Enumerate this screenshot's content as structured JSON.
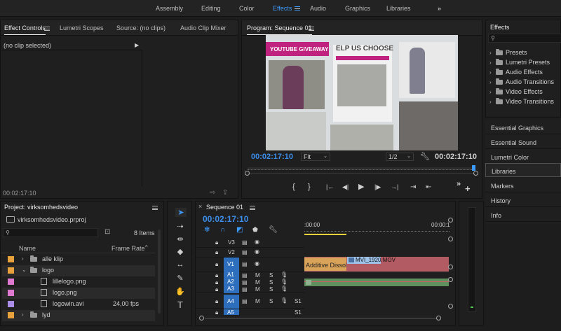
{
  "workspace": {
    "tabs": [
      "Assembly",
      "Editing",
      "Color",
      "Effects",
      "Audio",
      "Graphics",
      "Libraries"
    ],
    "active": "Effects",
    "more": "»"
  },
  "effect_controls": {
    "tabs": [
      "Effect Controls",
      "Lumetri Scopes",
      "Source: (no clips)",
      "Audio Clip Mixer"
    ],
    "no_clip": "(no clip selected)",
    "timecode": "00:02:17:10"
  },
  "program": {
    "title": "Program: Sequence 01",
    "timecode_left": "00:02:17:10",
    "fit": "Fit",
    "resolution": "1/2",
    "timecode_right": "00:02:17:10",
    "video_text_1": "YOUTUBE GIVEAWAY",
    "video_text_2": "ELP US CHOOSE",
    "controls": [
      "{",
      "}",
      "|←",
      "◀|",
      "▶",
      "|▶",
      "→|",
      "⇥",
      "⇤",
      "»",
      "+"
    ]
  },
  "effects_panel": {
    "title": "Effects",
    "tree": [
      "Presets",
      "Lumetri Presets",
      "Audio Effects",
      "Audio Transitions",
      "Video Effects",
      "Video Transitions"
    ],
    "sections": [
      "Essential Graphics",
      "Essential Sound",
      "Lumetri Color",
      "Libraries",
      "Markers",
      "History",
      "Info"
    ],
    "selected_section": "Libraries"
  },
  "project": {
    "title": "Project: virksomhedsvideo",
    "file": "virksomhedsvideo.prproj",
    "items_count": "8 Items",
    "col_name": "Name",
    "col_rate": "Frame Rate",
    "rows": [
      {
        "name": "alle klip",
        "rate": "",
        "color": "#e8a23c",
        "type": "folder",
        "indent": 0,
        "expanded": false
      },
      {
        "name": "logo",
        "rate": "",
        "color": "#e8a23c",
        "type": "folder",
        "indent": 0,
        "expanded": true
      },
      {
        "name": "lillelogo.png",
        "rate": "",
        "color": "#e07ad0",
        "type": "file",
        "indent": 1
      },
      {
        "name": "logo.png",
        "rate": "",
        "color": "#e07ad0",
        "type": "file",
        "indent": 1
      },
      {
        "name": "logowin.avi",
        "rate": "24,00 fps",
        "color": "#a98de6",
        "type": "file",
        "indent": 1
      },
      {
        "name": "lyd",
        "rate": "",
        "color": "#e8a23c",
        "type": "folder",
        "indent": 0,
        "expanded": false
      }
    ]
  },
  "sequence": {
    "title": "Sequence 01",
    "timecode": "00:02:17:10",
    "ruler_left": ":00:00",
    "ruler_right": "00:00:1",
    "video_tracks": [
      "V3",
      "V2",
      "V1"
    ],
    "audio_tracks": [
      "A1",
      "A2",
      "A3",
      "A4",
      "A5"
    ],
    "clip_transition": "Additive Dissolv",
    "clip_name": "MVI_1920.MOV",
    "track_m": "M",
    "track_s": "S",
    "s1_label": "S1"
  },
  "colors": {
    "accent": "#3d9bff",
    "clip_video": "#b35b62",
    "clip_audio": "#5f8f5f",
    "dissolve": "#d9a35a"
  }
}
